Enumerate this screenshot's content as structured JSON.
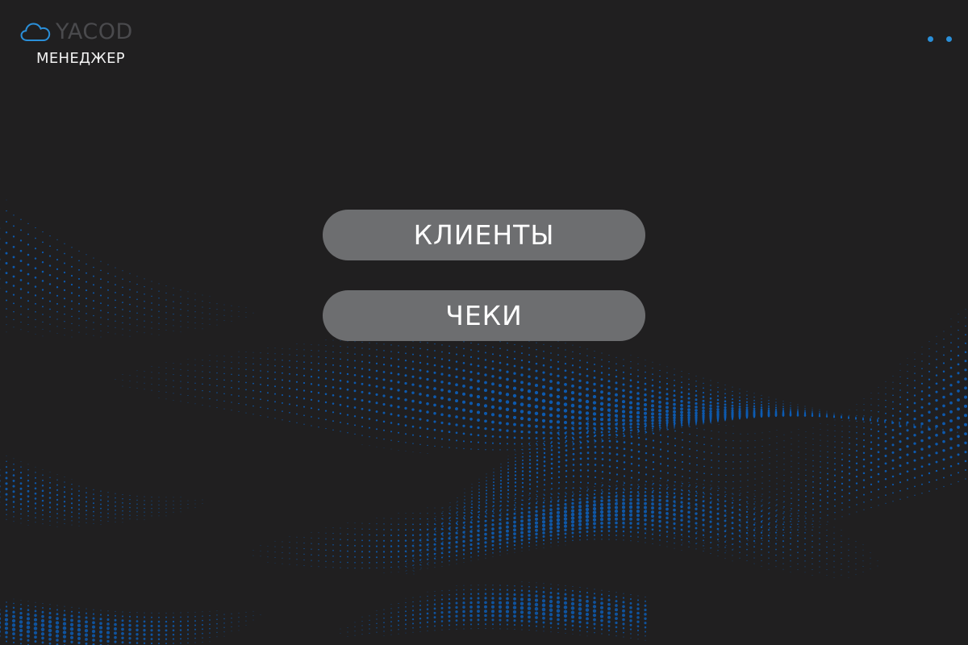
{
  "app": {
    "logo_text": "YACOD",
    "subtitle": "МЕНЕДЖЕР"
  },
  "menu": {
    "buttons": [
      {
        "label": "КЛИЕНТЫ"
      },
      {
        "label": "ЧЕКИ"
      }
    ]
  },
  "icons": {
    "logo": "cloud-icon",
    "menu": "more-dots-icon"
  },
  "colors": {
    "background": "#201f20",
    "button": "#6d6e70",
    "accent": "#2a8fd9",
    "wave": "#0d5db5",
    "logo_text": "#4a4a4d"
  }
}
